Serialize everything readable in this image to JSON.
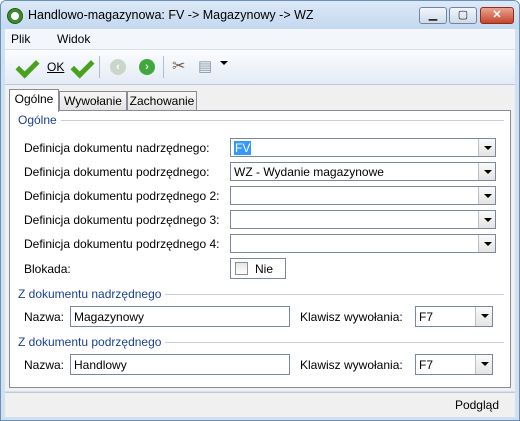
{
  "window": {
    "title": "Handlowo-magazynowa: FV -> Magazynowy -> WZ"
  },
  "menu": {
    "items": [
      "Plik",
      "Widok"
    ]
  },
  "toolbar": {
    "ok_label": "OK"
  },
  "tabs": [
    "Ogólne",
    "Wywołanie",
    "Zachowanie"
  ],
  "general": {
    "group_title": "Ogólne",
    "rows": [
      {
        "label": "Definicja dokumentu nadrzędnego:",
        "value": "FV"
      },
      {
        "label": "Definicja dokumentu podrzędnego:",
        "value": "WZ - Wydanie magazynowe"
      },
      {
        "label": "Definicja dokumentu podrzędnego 2:",
        "value": ""
      },
      {
        "label": "Definicja dokumentu podrzędnego 3:",
        "value": ""
      },
      {
        "label": "Definicja dokumentu podrzędnego 4:",
        "value": ""
      }
    ],
    "blokada_label": "Blokada:",
    "blokada_value": "Nie"
  },
  "from_parent": {
    "group_title": "Z dokumentu nadrzędnego",
    "name_label": "Nazwa:",
    "name_value": "Magazynowy",
    "key_label": "Klawisz wywołania:",
    "key_value": "F7"
  },
  "from_child": {
    "group_title": "Z dokumentu podrzędnego",
    "name_label": "Nazwa:",
    "name_value": "Handlowy",
    "key_label": "Klawisz wywołania:",
    "key_value": "F7"
  },
  "status": {
    "text": "Podgląd"
  }
}
